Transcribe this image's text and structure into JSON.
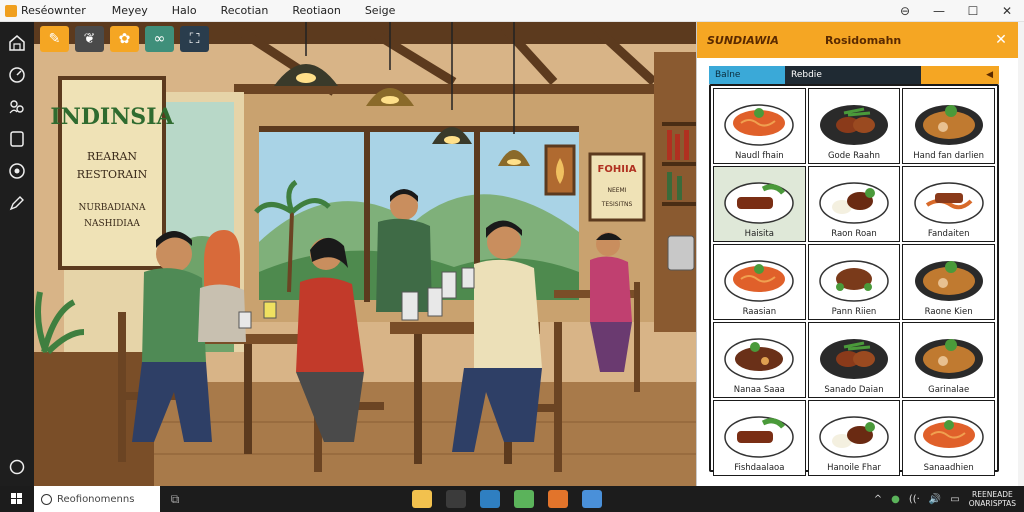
{
  "app": {
    "name": "Reséownter",
    "menu": [
      "Meyey",
      "Halo",
      "Recotian",
      "Reotiaon",
      "Seige"
    ],
    "window_controls": [
      "⊖",
      "—",
      "☐",
      "✕"
    ]
  },
  "canvas": {
    "toolbar": [
      {
        "icon": "brush-icon",
        "color": "#f5a623"
      },
      {
        "icon": "leaf-icon",
        "color": "#4a4a4a"
      },
      {
        "icon": "plate-icon",
        "color": "#f5a623"
      },
      {
        "icon": "link-icon",
        "color": "#3f8f7a"
      },
      {
        "icon": "expand-icon",
        "color": "#2a3d4d"
      }
    ],
    "signs": {
      "main_title": "INDINSIA",
      "main_lines": [
        "REARAN",
        "RESTORAIN",
        "NURBADIANA",
        "NASHIDIAA"
      ],
      "small_title": "FOHIIA",
      "small_lines": [
        "NEEMI",
        "TESISITNS"
      ]
    }
  },
  "panel": {
    "brand": "SUNDIAWIA",
    "title": "Rosidomahn",
    "close_label": "✕",
    "tabs": [
      "Balne",
      "Rebdie",
      "◀"
    ],
    "items": [
      {
        "label": "Naudl fhain",
        "dish": "noodle",
        "selected": false
      },
      {
        "label": "Gode Raahn",
        "dish": "meat-veg",
        "selected": false
      },
      {
        "label": "Hand fan darlien",
        "dish": "stew-peas",
        "selected": false
      },
      {
        "label": "Haisita",
        "dish": "ribs-salad",
        "selected": true
      },
      {
        "label": "Raon Roan",
        "dish": "rice-meat",
        "selected": false
      },
      {
        "label": "Fandaiten",
        "dish": "meat-noodle",
        "selected": false
      },
      {
        "label": "Raasian",
        "dish": "noodle",
        "selected": false
      },
      {
        "label": "Pann Riien",
        "dish": "chicken",
        "selected": false
      },
      {
        "label": "Raone Kien",
        "dish": "stew-peas",
        "selected": false
      },
      {
        "label": "Nanaa Saaa",
        "dish": "stew",
        "selected": false
      },
      {
        "label": "Sanado Daian",
        "dish": "meat-veg",
        "selected": false
      },
      {
        "label": "Garinalae",
        "dish": "stew-peas",
        "selected": false
      },
      {
        "label": "Fishdaalaoa",
        "dish": "ribs-salad",
        "selected": false
      },
      {
        "label": "Hanoile Fhar",
        "dish": "rice-meat",
        "selected": false
      },
      {
        "label": "Sanaadhien",
        "dish": "noodle",
        "selected": false
      }
    ]
  },
  "taskbar": {
    "search_placeholder": "Reofionomenns",
    "apps": [
      {
        "name": "folder",
        "color": "#f2c14e"
      },
      {
        "name": "store",
        "color": "#3b3b3b"
      },
      {
        "name": "photos",
        "color": "#2f7fc1"
      },
      {
        "name": "browser",
        "color": "#5bb35b"
      },
      {
        "name": "media",
        "color": "#e2742b"
      },
      {
        "name": "mail",
        "color": "#4a90d9"
      }
    ],
    "tray_icons": [
      "^",
      "●",
      "((·",
      "🔊",
      "▭"
    ],
    "clock_line1": "REENEADE",
    "clock_line2": "ONARISPTAS"
  }
}
